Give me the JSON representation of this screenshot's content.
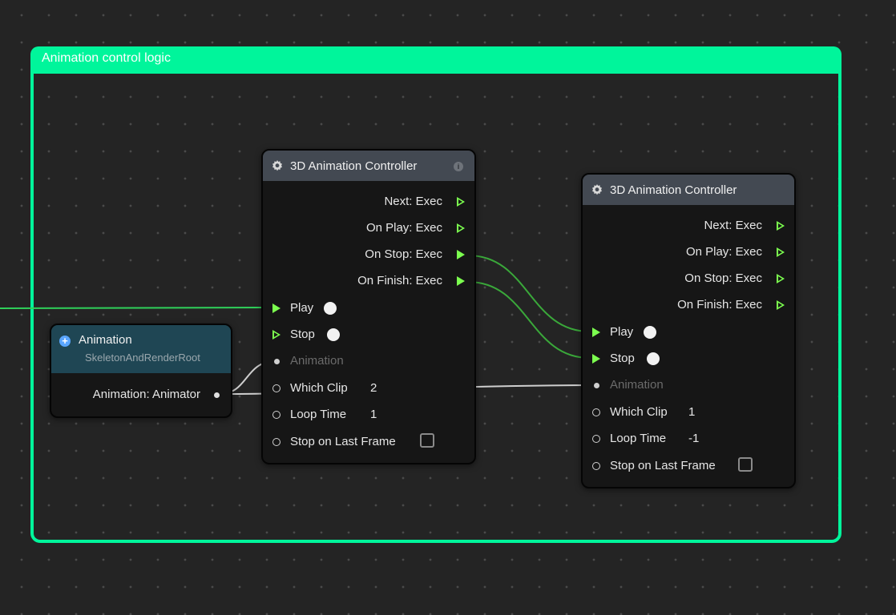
{
  "group": {
    "title": "Animation control logic"
  },
  "colors": {
    "group": "#00f59b",
    "exec": "#7cff4f",
    "header": "#434952",
    "component_header": "#1f4654"
  },
  "animation_node": {
    "title": "Animation",
    "subtitle": "SkeletonAndRenderRoot",
    "output_label": "Animation: Animator"
  },
  "controller_a": {
    "title": "3D Animation Controller",
    "outputs": [
      "Next: Exec",
      "On Play: Exec",
      "On Stop: Exec",
      "On Finish: Exec"
    ],
    "inputs": {
      "play": "Play",
      "stop": "Stop",
      "animation": "Animation",
      "which_clip": "Which Clip",
      "which_clip_value": "2",
      "loop_time": "Loop Time",
      "loop_time_value": "1",
      "stop_last_frame": "Stop on Last Frame"
    }
  },
  "controller_b": {
    "title": "3D Animation Controller",
    "outputs": [
      "Next: Exec",
      "On Play: Exec",
      "On Stop: Exec",
      "On Finish: Exec"
    ],
    "inputs": {
      "play": "Play",
      "stop": "Stop",
      "animation": "Animation",
      "which_clip": "Which Clip",
      "which_clip_value": "1",
      "loop_time": "Loop Time",
      "loop_time_value": "-1",
      "stop_last_frame": "Stop on Last Frame"
    }
  }
}
